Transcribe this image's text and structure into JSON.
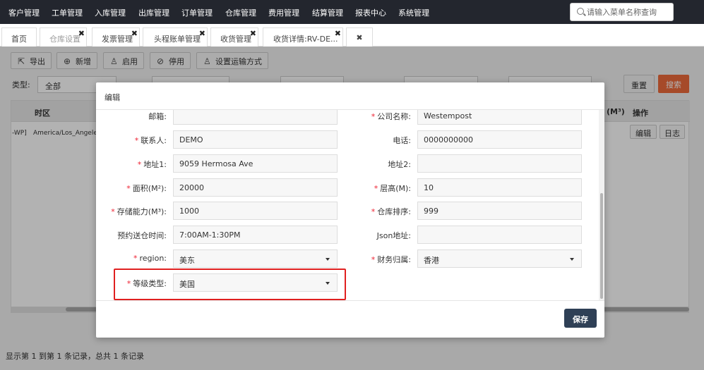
{
  "nav": {
    "items": [
      "客户管理",
      "工单管理",
      "入库管理",
      "出库管理",
      "订单管理",
      "仓库管理",
      "费用管理",
      "结算管理",
      "报表中心",
      "系统管理"
    ],
    "search_placeholder": "请输入菜单名称查询"
  },
  "tabs": [
    {
      "label": "首页"
    },
    {
      "label": "仓库设置"
    },
    {
      "label": "发票管理"
    },
    {
      "label": "头程账单管理"
    },
    {
      "label": "收货管理"
    },
    {
      "label": "收货详情:RV-DE..."
    }
  ],
  "tab_close_symbol": "✖",
  "toolbar": {
    "export": "导出",
    "add": "新增",
    "enable": "启用",
    "disable": "停用",
    "set_shipping": "设置运输方式"
  },
  "filters": {
    "type_label": "类型:",
    "type_value": "全部",
    "reset": "重置",
    "search": "搜索"
  },
  "table": {
    "col_timezone": "时区",
    "col_volume": "(M³)",
    "col_action": "操作",
    "row": {
      "id_fragment": "-WP]",
      "timezone": "America/Los_Angeles",
      "edit": "编辑",
      "log": "日志"
    }
  },
  "footer": "显示第 1 到第 1 条记录，总共 1 条记录",
  "modal": {
    "title": "编辑",
    "save": "保存",
    "left_fields": [
      {
        "label": "邮箱:",
        "required": false,
        "value": ""
      },
      {
        "label": "联系人:",
        "required": true,
        "value": "DEMO"
      },
      {
        "label": "地址1:",
        "required": true,
        "value": "9059 Hermosa Ave"
      },
      {
        "label": "面积(M²):",
        "required": true,
        "value": "20000"
      },
      {
        "label": "存储能力(M³):",
        "required": true,
        "value": "1000"
      },
      {
        "label": "预约送仓时间:",
        "required": false,
        "value": "7:00AM-1:30PM"
      },
      {
        "label": "region:",
        "required": true,
        "value": "美东",
        "select": true
      },
      {
        "label": "等级类型:",
        "required": true,
        "value": "美国",
        "select": true
      }
    ],
    "right_fields": [
      {
        "label": "公司名称:",
        "required": true,
        "value": "Westempost"
      },
      {
        "label": "电话:",
        "required": false,
        "value": "0000000000"
      },
      {
        "label": "地址2:",
        "required": false,
        "value": ""
      },
      {
        "label": "层高(M):",
        "required": true,
        "value": "10"
      },
      {
        "label": "仓库排序:",
        "required": true,
        "value": "999"
      },
      {
        "label": "Json地址:",
        "required": false,
        "value": ""
      },
      {
        "label": "财务归属:",
        "required": true,
        "value": "香港",
        "select": true
      }
    ]
  },
  "colors": {
    "nav_bg": "#23262e",
    "save_bg": "#2f4056",
    "search_btn": "#ee6b3b",
    "required_mark": "#e23",
    "highlight": "#e02020"
  }
}
